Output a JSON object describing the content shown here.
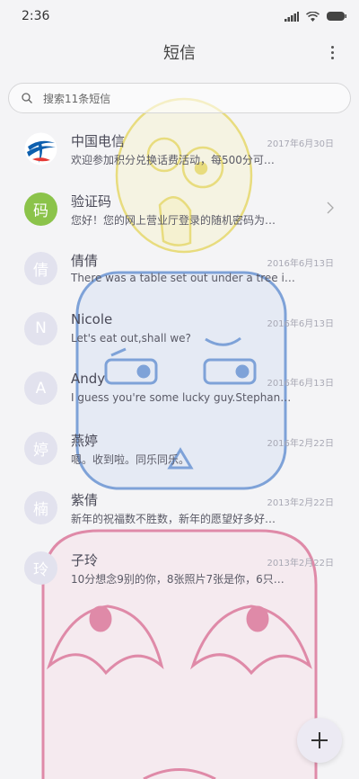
{
  "status_bar": {
    "time": "2:36"
  },
  "header": {
    "title": "短信"
  },
  "search": {
    "placeholder": "搜索11条短信"
  },
  "messages": [
    {
      "name": "中国电信",
      "date": "2017年6月30日",
      "preview": "欢迎参加积分兑换话费活动，每500分可…",
      "avatar_type": "logo",
      "avatar_text": ""
    },
    {
      "name": "验证码",
      "date": "",
      "preview": "您好！您的网上营业厅登录的随机密码为…",
      "avatar_type": "green",
      "avatar_text": "码"
    },
    {
      "name": "倩倩",
      "date": "2016年6月13日",
      "preview": "There was a table set out under a tree i…",
      "avatar_type": "plain",
      "avatar_text": "倩"
    },
    {
      "name": "Nicole",
      "date": "2016年6月13日",
      "preview": "Let's eat out,shall we?",
      "avatar_type": "plain",
      "avatar_text": "N"
    },
    {
      "name": "Andy",
      "date": "2016年6月13日",
      "preview": "I guess you're some lucky guy.Stephan…",
      "avatar_type": "plain",
      "avatar_text": "A"
    },
    {
      "name": "燕婷",
      "date": "2016年2月22日",
      "preview": "嗯。收到啦。同乐同乐。",
      "avatar_type": "plain",
      "avatar_text": "婷"
    },
    {
      "name": "紫倩",
      "date": "2013年2月22日",
      "preview": "新年的祝福数不胜数，新年的愿望好多好…",
      "avatar_type": "plain",
      "avatar_text": "楠"
    },
    {
      "name": "子玲",
      "date": "2013年2月22日",
      "preview": "10分想念9别的你，8张照片7张是你，6只…",
      "avatar_type": "plain",
      "avatar_text": "玲"
    }
  ],
  "colors": {
    "accent_green": "#8bc34a",
    "telecom_blue": "#0d5fae",
    "avatar_bg": "#e2e2ee"
  },
  "icons": {
    "status": [
      "signal-icon",
      "wifi-icon",
      "battery-icon"
    ],
    "fab": "plus-icon",
    "more": "more-vertical-icon",
    "search": "search-icon"
  }
}
